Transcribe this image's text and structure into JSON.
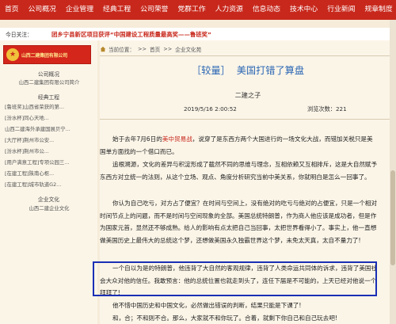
{
  "nav": {
    "items": [
      "首页",
      "公司概况",
      "企业管理",
      "经典工程",
      "公司荣誉",
      "党群工作",
      "人力资源",
      "信息动态",
      "技术中心",
      "行业新闻",
      "规章制度"
    ]
  },
  "notice": {
    "today_label": "今日关注：",
    "headline": "团乡宁县新区项目获评“中国建设工程质量最高奖——鲁班奖”"
  },
  "sidebar": {
    "logo_text": "山西二建集团有限公司",
    "group1_title": "公司概况",
    "group1_item": "山西二建集团有限公司简介",
    "group2_title": "经典工程",
    "classic_items": [
      "[鲁班奖]山西省荣获的第...",
      "[汾水杯]同心天地...",
      "山西二建海外承建国展贝宁...",
      "[大厅杯]荆州市公安...",
      "[汾水杯]荆州市公...",
      "[用户满意工程]专项公园三...",
      "[在建工程]陕南心枢...",
      "[在建工程]城市轨道G2..."
    ],
    "group3_title": "企业文化",
    "group3_item": "山西二建企业文化"
  },
  "breadcrumb": {
    "location_label": "当前位置：",
    "items": [
      ">>",
      "首页",
      ">>",
      "企业文化苑"
    ]
  },
  "article": {
    "category": "［较量］",
    "title": "美国打错了算盘",
    "author": "二建之子",
    "date": "2019/5/16 2:00:52",
    "views_label": "浏览次数：",
    "views": "221",
    "p1_before": "始于去年7月6日的",
    "p1_red": "美中贸易战",
    "p1_after": "，说穿了是东西方两个大国进行的一场文化大战，而错加关税只是美国单方面找的一个借口而已。",
    "p2": "追根溯源，文化的差异与积淀形成了截然不同的思维与理念，互相依赖又互相排斥，这是大自然赋予东西方对立统一的法则，从这个立场、观点、角度分析研究当前中美关系，你就明白是怎么一回事了。",
    "p3": "你认为自己吃亏，对方占了便宜？在时间与空间上，没有绝对的吃亏与绝对的占便宜，只是一个相对时间节点上的问题，而不是时间与空间现象的全部。美国总统特朗普，作为商人他应该是成功者，但是作为国家元首，显然还不够成熟。给人的影响有点太把自己当回事，太把世界看得小了。事实上，他一直想做美国历史上最伟大的总统这个梦，还想做美国永久独霸世界这个梦，未免太天真，太自不量力了!",
    "p4": "一个自以为是的特朗普，他违背了大自然的客观规律，违背了人类命运共同体的诉求，违背了美国社会大众对他的信任。我敢预言：他的总统位置也就走到头了，连任下届是不可能的，上天已经对他说一个拜拜了!",
    "p5": "他不惜中国历史和中国文化，必然做出错误的判断，结果只能是下课了!",
    "p6": "和，合；不和则不合。那么，大家就不和你玩了。合着，就剩下你自己和自己玩去吧!"
  },
  "colors": {
    "nav_red": "#c8281c",
    "title_blue": "#2a66b3",
    "highlight_blue": "#1a2fb5",
    "page_bg": "#f6ecd9"
  }
}
